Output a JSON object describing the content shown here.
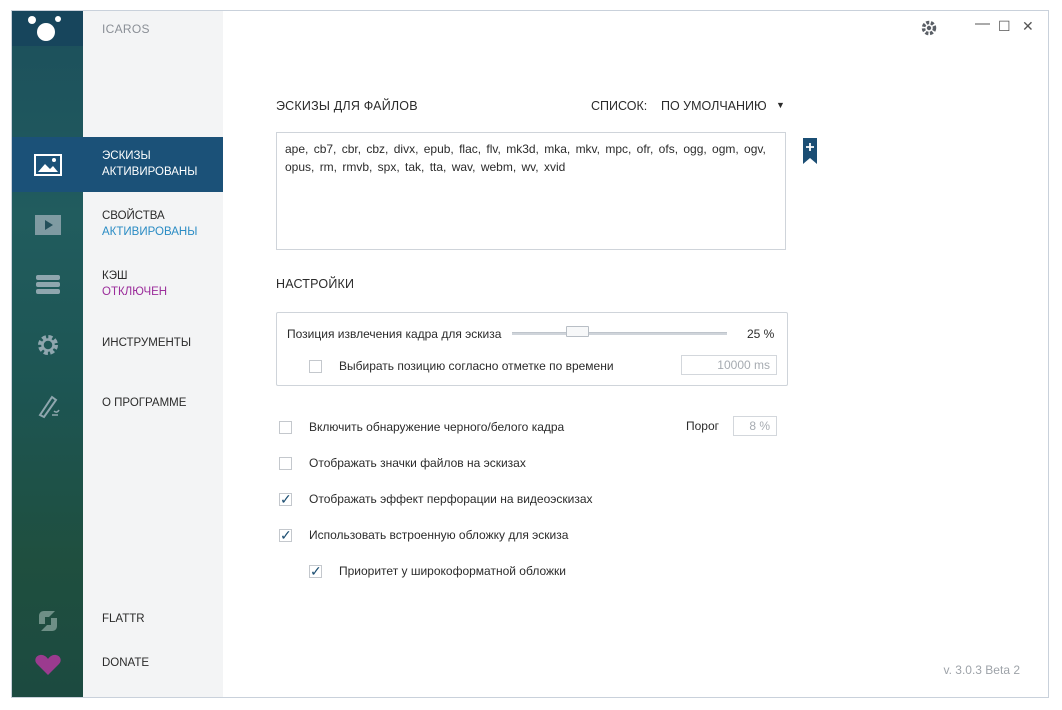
{
  "app": {
    "title": "ICAROS"
  },
  "window_controls": {
    "settings_icon": "gear-icon",
    "minimize": "—",
    "maximize": "☐",
    "close": "✕"
  },
  "sidebar": {
    "items": [
      {
        "id": "thumbnails",
        "icon": "image-icon",
        "label": "ЭСКИЗЫ",
        "status": "АКТИВИРОВАНЫ",
        "active": true
      },
      {
        "id": "properties",
        "icon": "play-icon",
        "label": "СВОЙСТВА",
        "status": "АКТИВИРОВАНЫ",
        "active": false
      },
      {
        "id": "cache",
        "icon": "database-icon",
        "label": "КЭШ",
        "status": "ОТКЛЮЧЕН",
        "active": false
      },
      {
        "id": "tools",
        "icon": "gear-icon",
        "label": "ИНСТРУМЕНТЫ"
      },
      {
        "id": "about",
        "icon": "quill-icon",
        "label": "О ПРОГРАММЕ"
      }
    ],
    "bottom": [
      {
        "id": "flattr",
        "icon": "flattr-icon",
        "label": "FLATTR"
      },
      {
        "id": "donate",
        "icon": "heart-icon",
        "label": "DONATE"
      }
    ]
  },
  "main": {
    "extensions_heading": "ЭСКИЗЫ ДЛЯ ФАЙЛОВ",
    "list_label": "СПИСОК:",
    "list_value": "ПО УМОЛЧАНИЮ",
    "extensions_text": "ape, cb7, cbr, cbz, divx, epub, flac, flv, mk3d, mka, mkv, mpc, ofr, ofs, ogg, ogm, ogv, opus, rm, rmvb, spx, tak, tta, wav, webm, wv, xvid",
    "settings_heading": "НАСТРОЙКИ",
    "frame_position_label": "Позиция извлечения кадра для эскиза",
    "frame_position_value": "25 %",
    "frame_position_fraction": 0.25,
    "timestamp_label": "Выбирать позицию согласно отметке по времени",
    "timestamp_value": "10000 ms",
    "bw_detect_label": "Включить обнаружение черного/белого кадра",
    "threshold_label": "Порог",
    "threshold_value": "8 %",
    "show_file_icons_label": "Отображать значки файлов на эскизах",
    "perforation_label": "Отображать эффект перфорации на видеоэскизах",
    "embedded_cover_label": "Использовать встроенную обложку для эскиза",
    "widescreen_label": "Приоритет у широкоформатной обложки",
    "checks": {
      "timestamp": false,
      "bw_detect": false,
      "file_icons": false,
      "perforation": true,
      "embedded_cover": true,
      "widescreen": true
    },
    "check_glyph": "✓",
    "version": "v. 3.0.3 Beta 2"
  },
  "colors": {
    "accent": "#1b5178",
    "active_status": "#2b8cc4",
    "disabled_status": "#9b2d9b",
    "donate": "#9b2d9b"
  }
}
